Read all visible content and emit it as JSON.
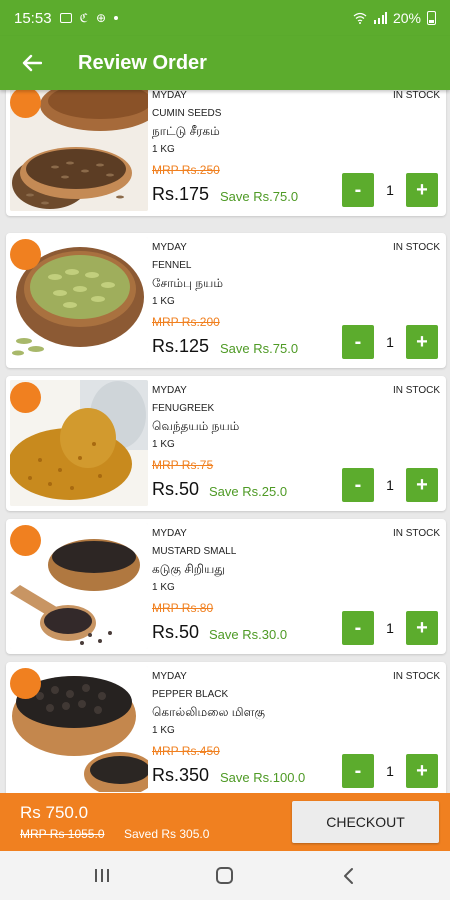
{
  "status_bar": {
    "time": "15:53",
    "battery": "20%"
  },
  "header": {
    "title": "Review Order"
  },
  "products": [
    {
      "brand": "MYDAY",
      "name": "CUMIN SEEDS",
      "tamil": "நாட்டு சீரகம்",
      "unit": "1 KG",
      "mrp": "MRP Rs.250",
      "price": "Rs.175",
      "save": "Save Rs.75.0",
      "stock": "IN STOCK",
      "qty": "1",
      "minus": "-",
      "plus": "+"
    },
    {
      "brand": "MYDAY",
      "name": "FENNEL",
      "tamil": "சோம்பு நயம்",
      "unit": "1 KG",
      "mrp": "MRP Rs.200",
      "price": "Rs.125",
      "save": "Save Rs.75.0",
      "stock": "IN STOCK",
      "qty": "1",
      "minus": "-",
      "plus": "+"
    },
    {
      "brand": "MYDAY",
      "name": "FENUGREEK",
      "tamil": "வெந்தயம் நயம்",
      "unit": "1 KG",
      "mrp": "MRP Rs.75",
      "price": "Rs.50",
      "save": "Save Rs.25.0",
      "stock": "IN STOCK",
      "qty": "1",
      "minus": "-",
      "plus": "+"
    },
    {
      "brand": "MYDAY",
      "name": "MUSTARD SMALL",
      "tamil": "கடுகு சிறியது",
      "unit": "1 KG",
      "mrp": "MRP Rs.80",
      "price": "Rs.50",
      "save": "Save Rs.30.0",
      "stock": "IN STOCK",
      "qty": "1",
      "minus": "-",
      "plus": "+"
    },
    {
      "brand": "MYDAY",
      "name": "PEPPER BLACK",
      "tamil": "கொல்லிமலை மிளகு",
      "unit": "1 KG",
      "mrp": "MRP Rs.450",
      "price": "Rs.350",
      "save": "Save Rs.100.0",
      "stock": "IN STOCK",
      "qty": "1",
      "minus": "-",
      "plus": "+"
    }
  ],
  "footer": {
    "total": "Rs 750.0",
    "mrp_total": "MRP Rs 1055.0",
    "saved": "Saved Rs 305.0",
    "checkout_label": "CHECKOUT"
  },
  "colors": {
    "primary": "#5cac2d",
    "accent": "#f08020"
  }
}
